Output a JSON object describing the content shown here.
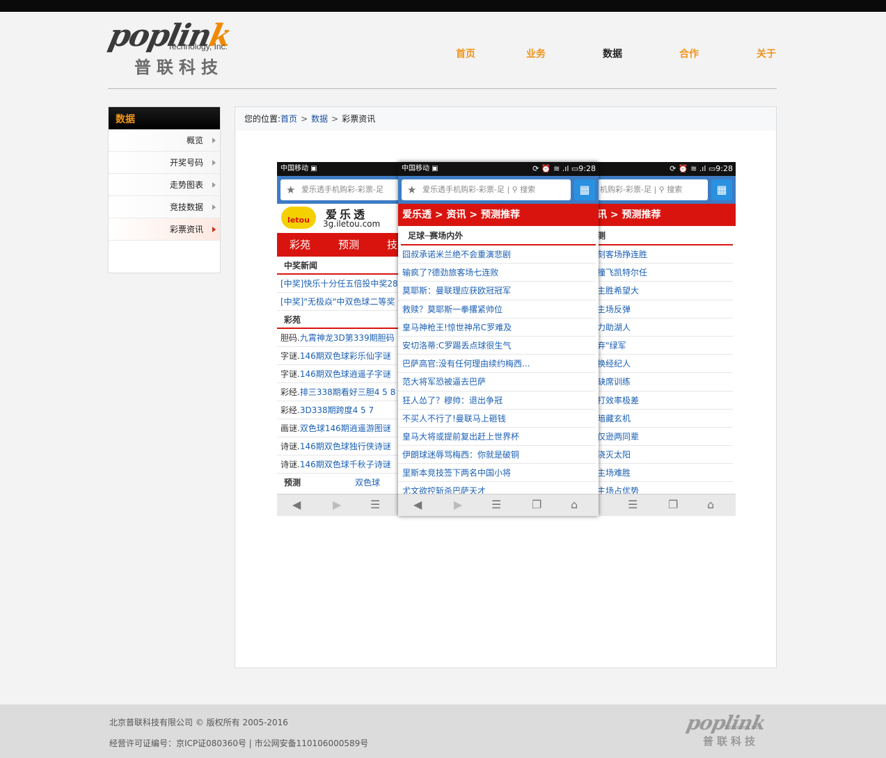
{
  "brand": {
    "wordmark": "poplink",
    "subtitle": "Technology, Inc.",
    "cn_name": "普联科技",
    "accent": "#f0941c"
  },
  "nav": [
    {
      "label": "首页",
      "active": false
    },
    {
      "label": "业务",
      "active": false
    },
    {
      "label": "数据",
      "active": true
    },
    {
      "label": "合作",
      "active": false
    },
    {
      "label": "关于",
      "active": false
    }
  ],
  "sidebar": {
    "title": "数据",
    "items": [
      {
        "label": "概览"
      },
      {
        "label": "开奖号码"
      },
      {
        "label": "走势图表"
      },
      {
        "label": "竞技数据"
      },
      {
        "label": "彩票资讯",
        "active": true
      }
    ]
  },
  "breadcrumb": {
    "prefix": "您的位置:",
    "home": "首页",
    "section": "数据",
    "current": "彩票资讯",
    "sep": ">"
  },
  "phone_common": {
    "carrier": "中国移动",
    "time": "9:28",
    "url_text": "爱乐透手机购彩-彩票-足",
    "url_text_short": "机购彩-彩票-足",
    "search": "搜索"
  },
  "phone1": {
    "brand_name": "爱乐透",
    "brand_url": "3g.iletou.com",
    "logo_text": "letou",
    "tabs": [
      "彩苑",
      "预测",
      "技"
    ],
    "news_title": "中奖新闻",
    "news": [
      "[中奖]快乐十分任五倍投中奖28",
      "[中奖]\"无极焱\"中双色球二等奖"
    ],
    "yc_title": "彩苑",
    "yc_items": [
      {
        "k": "胆码.",
        "t": "九霄神龙3D第339期胆码"
      },
      {
        "k": "字谜.",
        "t": "146期双色球彩乐仙字谜"
      },
      {
        "k": "字谜.",
        "t": "146期双色球逍遥子字谜"
      },
      {
        "k": "彩经.",
        "t": "排三338期看好三胆4 5 8"
      },
      {
        "k": "彩经.",
        "t": "3D338期跨度4 5 7"
      },
      {
        "k": "画谜.",
        "t": "双色球146期逍遥游图谜"
      },
      {
        "k": "诗谜.",
        "t": "146期双色球独行侠诗谜"
      },
      {
        "k": "诗谜.",
        "t": "146期双色球千秋子诗谜"
      }
    ],
    "yc_footer_left": "预测",
    "yc_footer_right": "双色球"
  },
  "phone2": {
    "red_title": "爱乐透 > 资讯 > 预测推荐",
    "section": "足球─赛场内外",
    "items": [
      "囧叔承诺米兰绝不会重演悲剧",
      "输疯了?德劲旅客场七连败",
      "莫耶斯：曼联理应获欧冠冠军",
      "救赎？莫耶斯一拳撂紧帅位",
      "皇马神枪王!惊世神吊C罗难及",
      "安切洛蒂:C罗踢丢点球很生气",
      "巴萨高官:没有任何理由续约梅西...",
      "范大将军恐被逼去巴萨",
      "狂人怂了？穆帅：退出争冠",
      "不买人不行了!曼联马上砸钱",
      "皇马大将或提前复出赶上世界杯",
      "伊朗球迷辱骂梅西：你就是破铜",
      "里斯本竞技签下两名中国小将",
      "尤文欲控斩杀巴萨天才"
    ]
  },
  "phone3": {
    "red_title": "讯 > 预测推荐",
    "section": "测",
    "items": [
      "刻客场挣连胜",
      "撞飞凯特尔任",
      "主胜希望大",
      "主场反弹",
      "力助湖人",
      "弃\"绿军",
      "换经纪人",
      "缺席训练",
      "打效率极差",
      "暗藏玄机",
      "仅逊两同辈",
      "浇灭太阳",
      "主场难胜",
      "主场占优势"
    ]
  },
  "footer": {
    "copyright": "北京普联科技有限公司 © 版权所有 2005-2016",
    "license": "经营许可证编号：京ICP证080360号 | 市公网安备110106000589号"
  }
}
